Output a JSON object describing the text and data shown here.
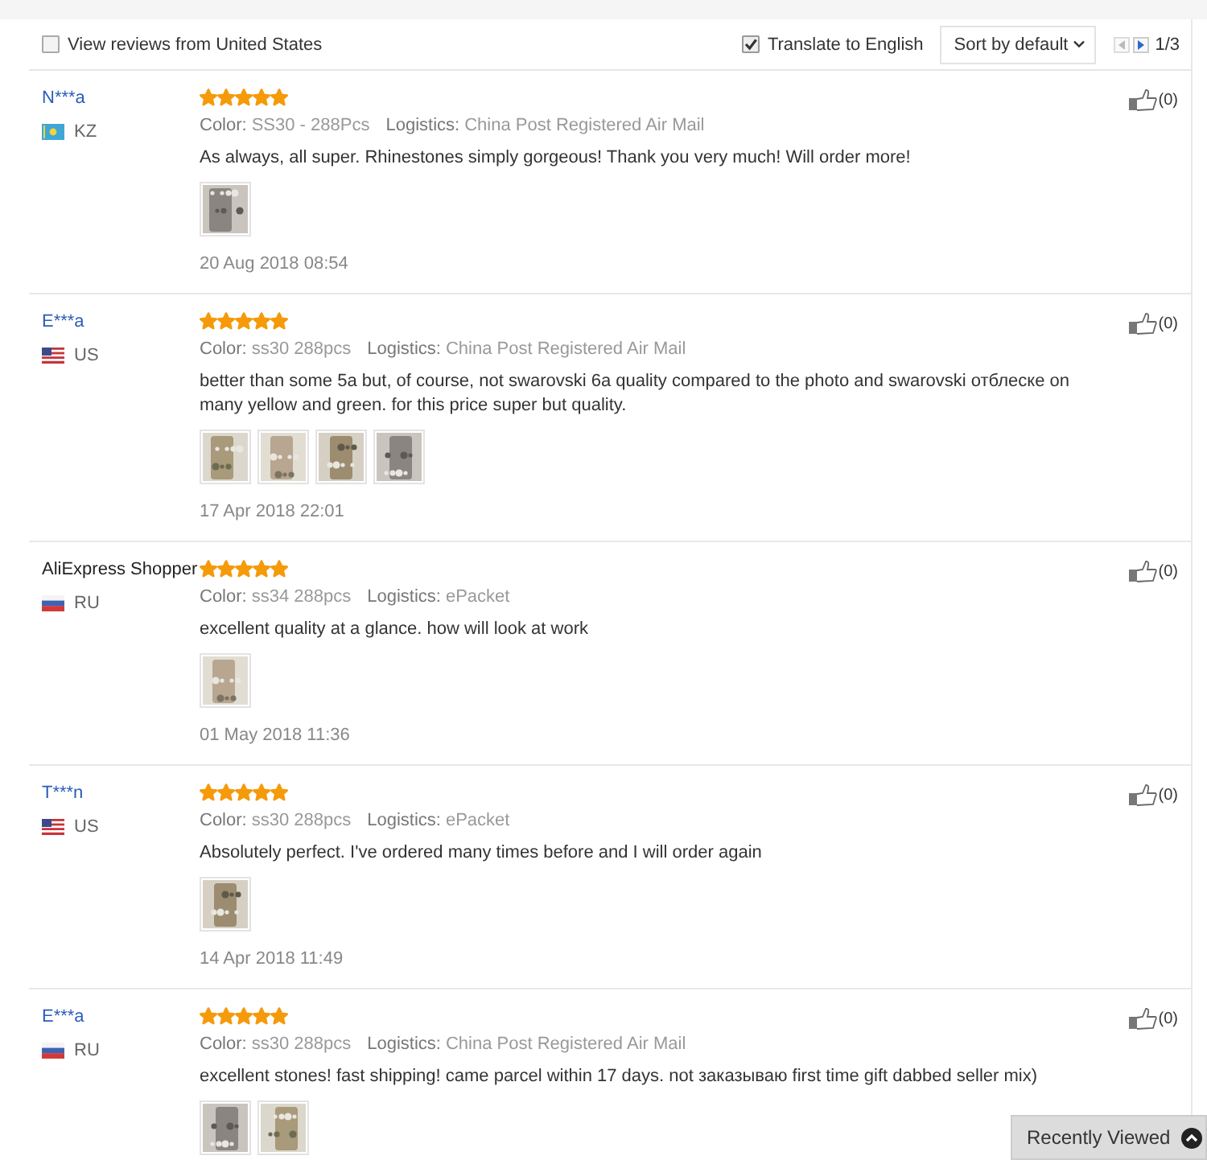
{
  "filters": {
    "us_only": {
      "label": "View reviews from United States",
      "checked": false
    },
    "translate": {
      "label": "Translate to English",
      "checked": true
    },
    "sort": {
      "value": "Sort by default"
    },
    "pager": {
      "prev_disabled": true,
      "next_disabled": false,
      "page": "1/3"
    }
  },
  "reviews": [
    {
      "name": "N***a",
      "is_link": true,
      "flag": {
        "kind": "kz"
      },
      "country": "KZ",
      "stars": 5,
      "color_label": "Color:",
      "color_value": "SS30 - 288Pcs",
      "logistics_label": "Logistics:",
      "logistics": "China Post Registered Air Mail",
      "text": "As always, all super. Rhinestones simply gorgeous! Thank you very much! Will order more!",
      "photos": [
        {
          "kind": "picture"
        }
      ],
      "date": "20 Aug 2018 08:54",
      "likes": "(0)"
    },
    {
      "name": "E***a",
      "is_link": true,
      "flag": {
        "kind": "us"
      },
      "country": "US",
      "stars": 5,
      "color_label": "Color:",
      "color_value": "ss30 288pcs",
      "logistics_label": "Logistics:",
      "logistics": "China Post Registered Air Mail",
      "text": "better than some 5a but, of course, not swarovski 6a quality compared to the photo and swarovski отблеске on many yellow and green. for this price super but quality.",
      "photos": [
        {
          "kind": "picture"
        },
        {
          "kind": "picture"
        },
        {
          "kind": "picture"
        },
        {
          "kind": "picture"
        }
      ],
      "date": "17 Apr 2018 22:01",
      "likes": "(0)"
    },
    {
      "name": "AliExpress Shopper",
      "is_link": false,
      "flag": {
        "kind": "ru"
      },
      "country": "RU",
      "stars": 5,
      "color_label": "Color:",
      "color_value": "ss34 288pcs",
      "logistics_label": "Logistics:",
      "logistics": "ePacket",
      "text": "excellent quality at a glance. how will look at work",
      "photos": [
        {
          "kind": "picture"
        }
      ],
      "date": "01 May 2018 11:36",
      "likes": "(0)"
    },
    {
      "name": "T***n",
      "is_link": true,
      "flag": {
        "kind": "us"
      },
      "country": "US",
      "stars": 5,
      "color_label": "Color:",
      "color_value": "ss30 288pcs",
      "logistics_label": "Logistics:",
      "logistics": "ePacket",
      "text": "Absolutely perfect. I've ordered many times before and I will order again",
      "photos": [
        {
          "kind": "picture"
        }
      ],
      "date": "14 Apr 2018 11:49",
      "likes": "(0)"
    },
    {
      "name": "E***a",
      "is_link": true,
      "flag": {
        "kind": "ru"
      },
      "country": "RU",
      "stars": 5,
      "color_label": "Color:",
      "color_value": "ss30 288pcs",
      "logistics_label": "Logistics:",
      "logistics": "China Post Registered Air Mail",
      "text": "excellent stones! fast shipping! came parcel within 17 days. not заказываю first time gift dabbed seller mix)",
      "photos": [
        {
          "kind": "picture"
        },
        {
          "kind": "picture"
        }
      ],
      "likes": "(0)"
    }
  ],
  "recently_viewed": {
    "label": "Recently Viewed"
  }
}
